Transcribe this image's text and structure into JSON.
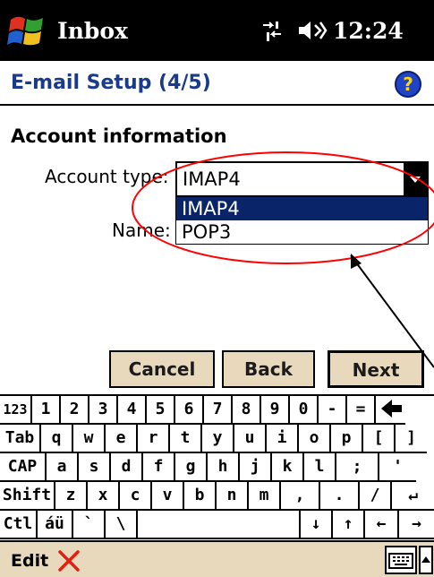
{
  "status_bar": {
    "app_title": "Inbox",
    "time": "12:24",
    "start_icon": "windows-flag-icon",
    "connection_icon": "connectivity-icon",
    "volume_icon": "speaker-icon"
  },
  "header": {
    "title": "E-mail Setup (4/5)",
    "help_icon": "help-icon"
  },
  "form": {
    "section_title": "Account information",
    "account_type_label": "Account type:",
    "account_type_value": "IMAP4",
    "name_label": "Name:",
    "options": [
      "IMAP4",
      "POP3"
    ],
    "selected_option": "IMAP4"
  },
  "buttons": {
    "cancel": "Cancel",
    "back": "Back",
    "next": "Next"
  },
  "keyboard": {
    "rows": [
      [
        "123",
        "1",
        "2",
        "3",
        "4",
        "5",
        "6",
        "7",
        "8",
        "9",
        "0",
        "-",
        "=",
        "◆"
      ],
      [
        "Tab",
        "q",
        "w",
        "e",
        "r",
        "t",
        "y",
        "u",
        "i",
        "o",
        "p",
        "[",
        "]"
      ],
      [
        "CAP",
        "a",
        "s",
        "d",
        "f",
        "g",
        "h",
        "j",
        "k",
        "l",
        ";",
        "'"
      ],
      [
        "Shift",
        "z",
        "x",
        "c",
        "v",
        "b",
        "n",
        "m",
        ",",
        ".",
        "/",
        "↵"
      ],
      [
        "Ctl",
        "áü",
        "`",
        "\\",
        "",
        "↓",
        "↑",
        "←",
        "→"
      ]
    ]
  },
  "menu_bar": {
    "edit_label": "Edit",
    "close_icon": "close-x-icon",
    "input_icon": "keyboard-icon"
  },
  "colors": {
    "highlight": "#0a246a",
    "title_text": "#1a3a8a",
    "button_face": "#e8d8bc",
    "annotation": "#ff0000"
  }
}
